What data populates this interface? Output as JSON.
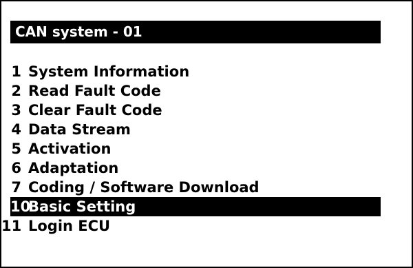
{
  "header": {
    "title": "CAN system - 01"
  },
  "menu": {
    "items": [
      {
        "number": "1",
        "label": "System Information",
        "selected": false
      },
      {
        "number": "2",
        "label": "Read Fault Code",
        "selected": false
      },
      {
        "number": "3",
        "label": "Clear Fault Code",
        "selected": false
      },
      {
        "number": "4",
        "label": "Data Stream",
        "selected": false
      },
      {
        "number": "5",
        "label": "Activation",
        "selected": false
      },
      {
        "number": "6",
        "label": "Adaptation",
        "selected": false
      },
      {
        "number": "7",
        "label": "Coding / Software Download",
        "selected": false
      },
      {
        "number": "10",
        "label": "Basic Setting",
        "selected": true
      },
      {
        "number": "11",
        "label": "Login ECU",
        "selected": false
      }
    ]
  },
  "colors": {
    "background": "#ffffff",
    "foreground": "#000000",
    "highlight_background": "#000000",
    "highlight_foreground": "#ffffff"
  }
}
